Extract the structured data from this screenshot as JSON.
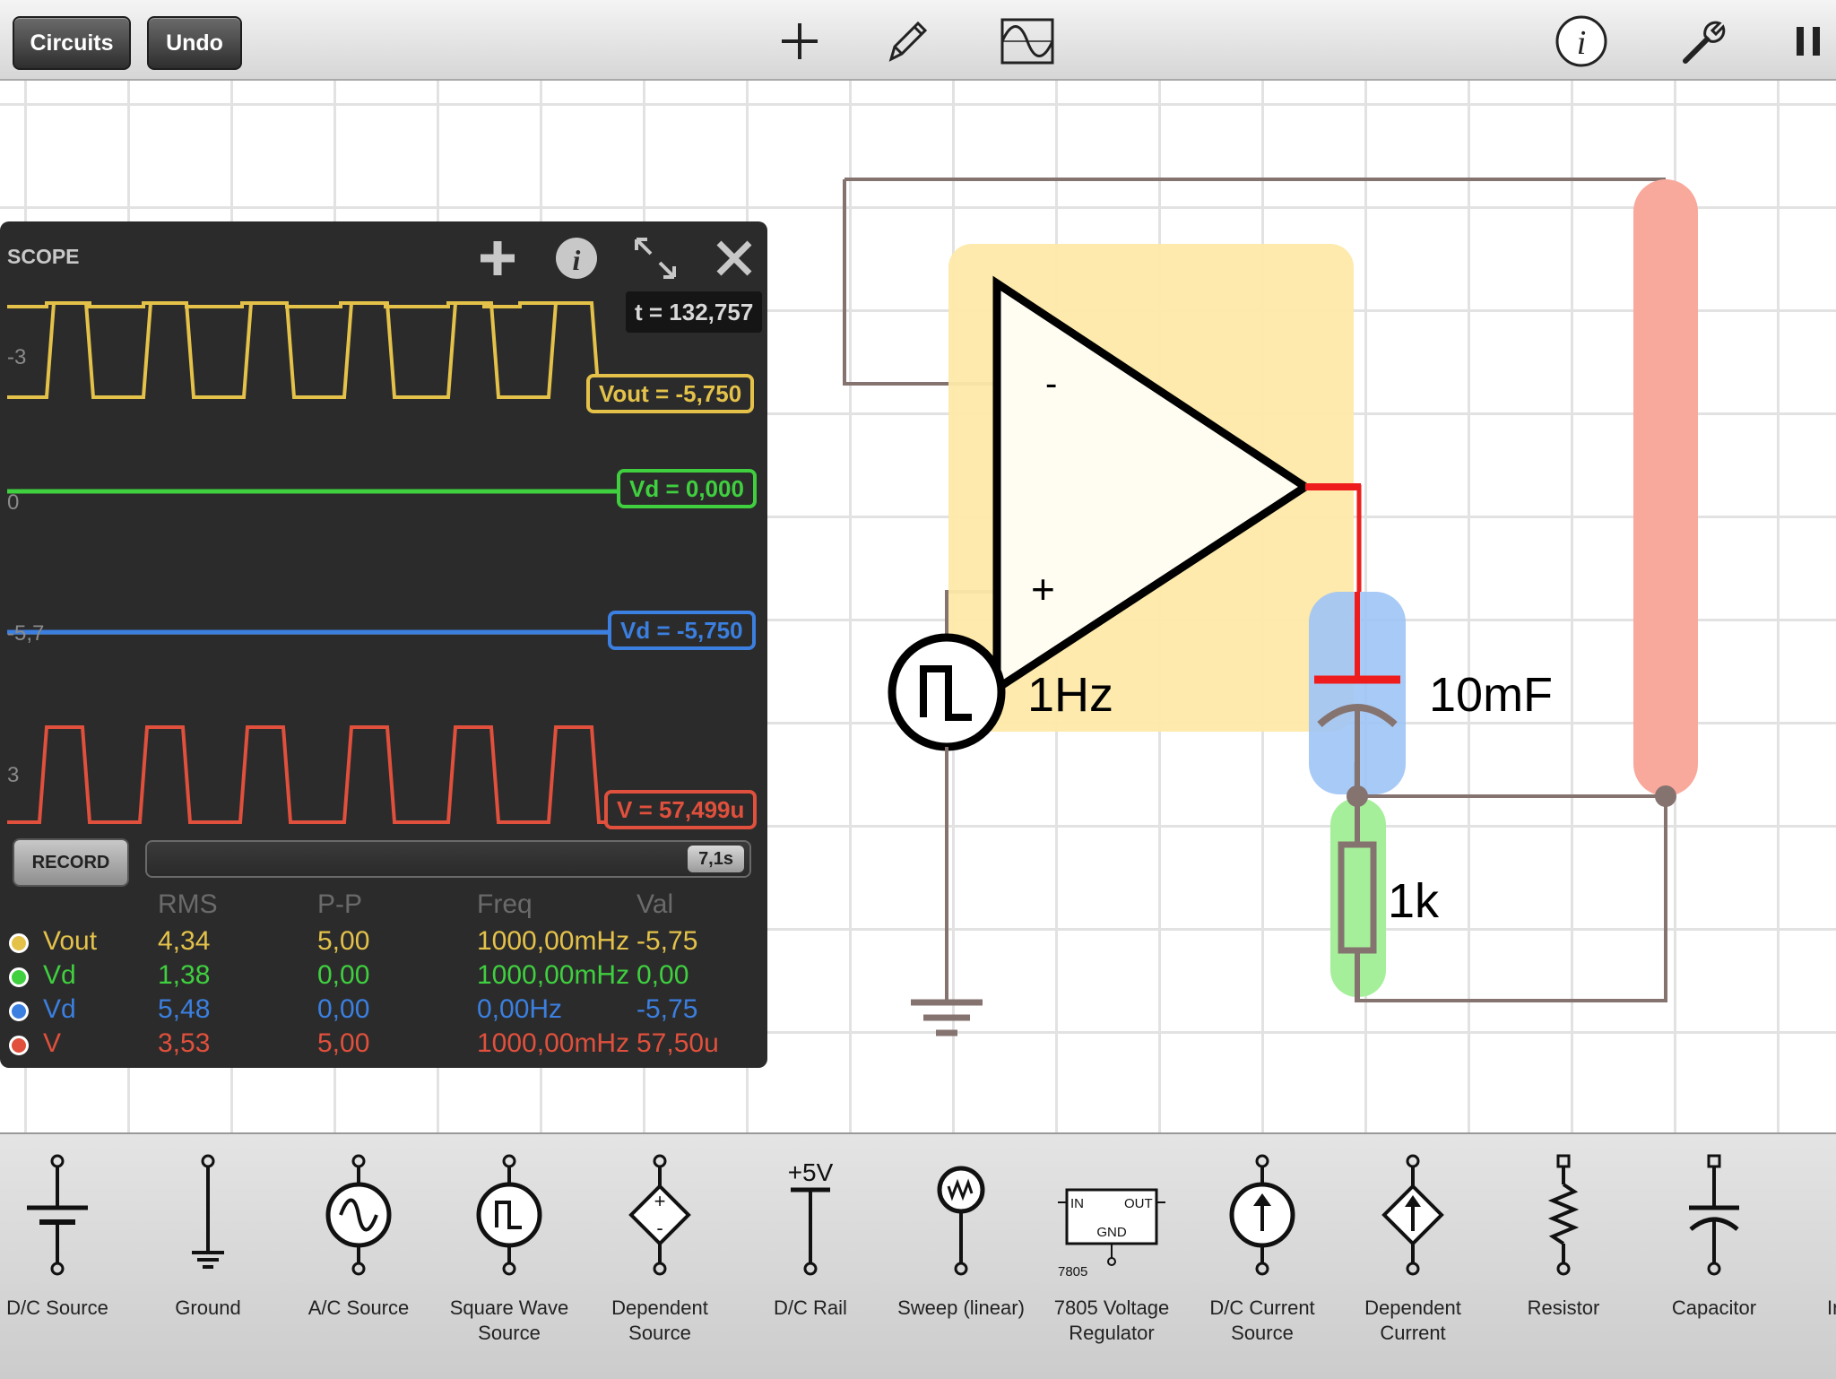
{
  "toolbar": {
    "circuits_label": "Circuits",
    "undo_label": "Undo"
  },
  "circuit": {
    "opamp_minus": "-",
    "opamp_plus": "+",
    "source_freq": "1Hz",
    "capacitor_value": "10mF",
    "resistor_value": "1k"
  },
  "scope": {
    "title": "SCOPE",
    "time_readout": "t = 132,757",
    "axis": [
      "-3",
      "0",
      "-5,7",
      "3"
    ],
    "probes": [
      {
        "label": "Vout = -5,750",
        "color": "#e4c24a"
      },
      {
        "label": "Vd = 0,000",
        "color": "#3fcf3f"
      },
      {
        "label": "Vd = -5,750",
        "color": "#3b7fe0"
      },
      {
        "label": "V = 57,499u",
        "color": "#e0503c"
      }
    ],
    "record_label": "RECORD",
    "record_time": "7,1s",
    "columns": [
      "RMS",
      "P-P",
      "Freq",
      "Val"
    ],
    "rows": [
      {
        "name": "Vout",
        "rms": "4,34",
        "pp": "5,00",
        "freq": "1000,00mHz",
        "val": "-5,75",
        "color": "#e4c24a"
      },
      {
        "name": "Vd",
        "rms": "1,38",
        "pp": "0,00",
        "freq": "1000,00mHz",
        "val": "0,00",
        "color": "#3fcf3f"
      },
      {
        "name": "Vd",
        "rms": "5,48",
        "pp": "0,00",
        "freq": "0,00Hz",
        "val": "-5,75",
        "color": "#3b7fe0"
      },
      {
        "name": "V",
        "rms": "3,53",
        "pp": "5,00",
        "freq": "1000,00mHz",
        "val": "57,50u",
        "color": "#e0503c"
      }
    ]
  },
  "palette": {
    "items": [
      {
        "label": "D/C Source"
      },
      {
        "label": "Ground"
      },
      {
        "label": "A/C Source"
      },
      {
        "label": "Square Wave Source"
      },
      {
        "label": "Dependent Source"
      },
      {
        "label": "D/C Rail",
        "extra": "+5V"
      },
      {
        "label": "Sweep (linear)"
      },
      {
        "label": "7805 Voltage Regulator",
        "extra_in": "IN",
        "extra_out": "OUT",
        "extra_gnd": "GND",
        "extra_part": "7805"
      },
      {
        "label": "D/C Current Source"
      },
      {
        "label": "Dependent Current"
      },
      {
        "label": "Resistor"
      },
      {
        "label": "Capacitor"
      },
      {
        "label": "In"
      }
    ]
  }
}
